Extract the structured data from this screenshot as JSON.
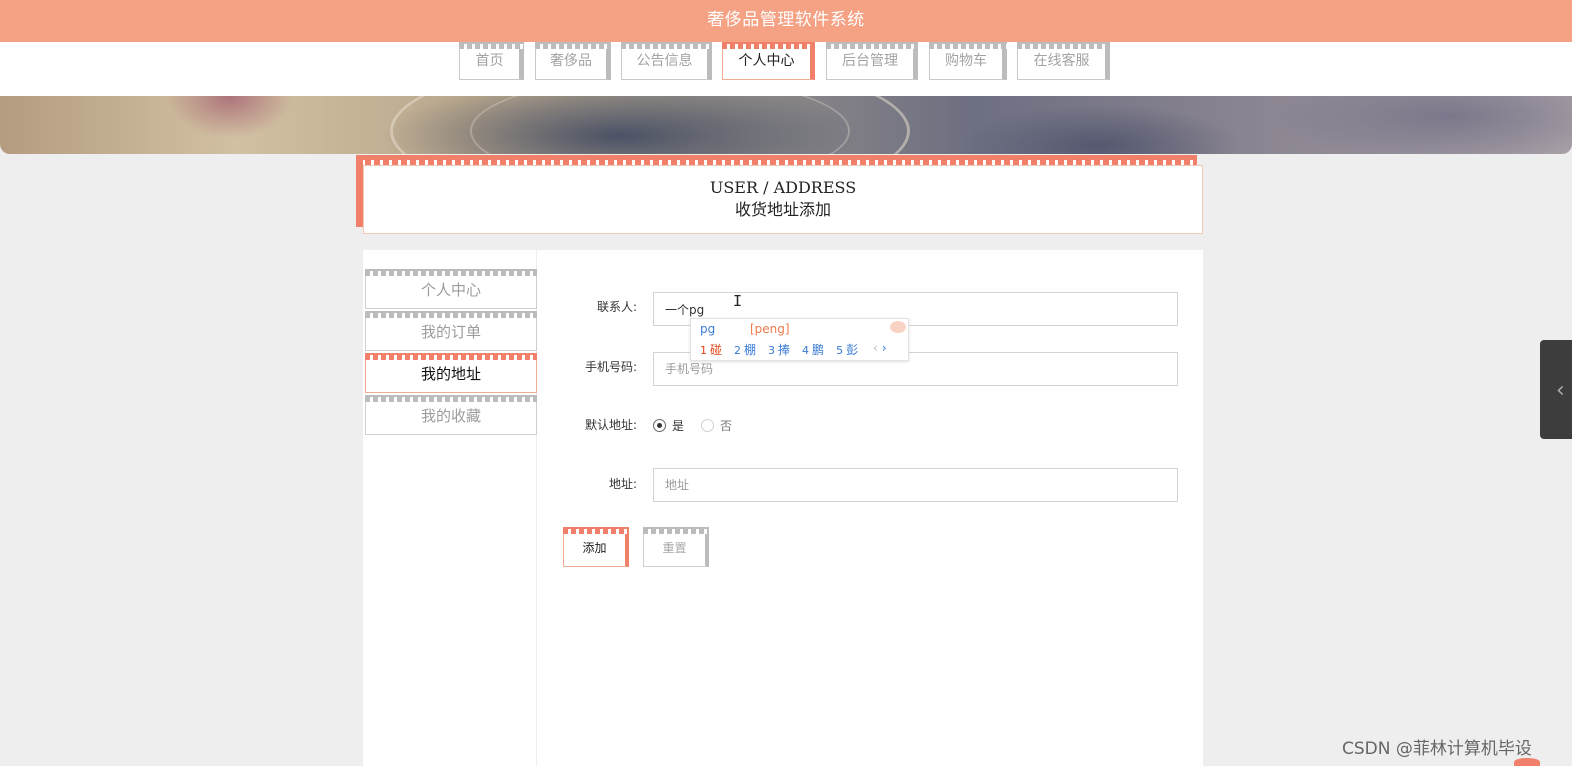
{
  "app": {
    "title": "奢侈品管理软件系统"
  },
  "nav": {
    "tabs": [
      {
        "label": "首页",
        "active": false
      },
      {
        "label": "奢侈品",
        "active": false
      },
      {
        "label": "公告信息",
        "active": false
      },
      {
        "label": "个人中心",
        "active": true
      },
      {
        "label": "后台管理",
        "active": false
      },
      {
        "label": "购物车",
        "active": false
      },
      {
        "label": "在线客服",
        "active": false
      }
    ]
  },
  "page_header": {
    "title_en": "USER / ADDRESS",
    "title_cn": "收货地址添加"
  },
  "sidebar": {
    "items": [
      {
        "label": "个人中心",
        "active": false
      },
      {
        "label": "我的订单",
        "active": false
      },
      {
        "label": "我的地址",
        "active": true
      },
      {
        "label": "我的收藏",
        "active": false
      }
    ]
  },
  "form": {
    "contact": {
      "label": "联系人:",
      "value": "一个pg",
      "placeholder": ""
    },
    "phone": {
      "label": "手机号码:",
      "value": "",
      "placeholder": "手机号码"
    },
    "default_address": {
      "label": "默认地址:",
      "options": [
        {
          "label": "是",
          "checked": true
        },
        {
          "label": "否",
          "checked": false
        }
      ]
    },
    "address": {
      "label": "地址:",
      "value": "",
      "placeholder": "地址"
    },
    "add_button": "添加",
    "reset_button": "重置"
  },
  "ime": {
    "input": "pg",
    "pinyin": "[peng]",
    "candidates": [
      {
        "num": "1",
        "text": "碰"
      },
      {
        "num": "2",
        "text": "棚"
      },
      {
        "num": "3",
        "text": "捧"
      },
      {
        "num": "4",
        "text": "鹏"
      },
      {
        "num": "5",
        "text": "彭"
      }
    ],
    "prev": "‹",
    "next": "›"
  },
  "watermark": "CSDN @菲林计算机毕设",
  "colors": {
    "topbar": "#f4a184",
    "accent": "#f1806a",
    "inactive": "#bcbcbc",
    "background": "#efeeef"
  },
  "icons": {
    "side_tab": "chevron-left-icon",
    "text_cursor": "text-cursor-icon"
  }
}
